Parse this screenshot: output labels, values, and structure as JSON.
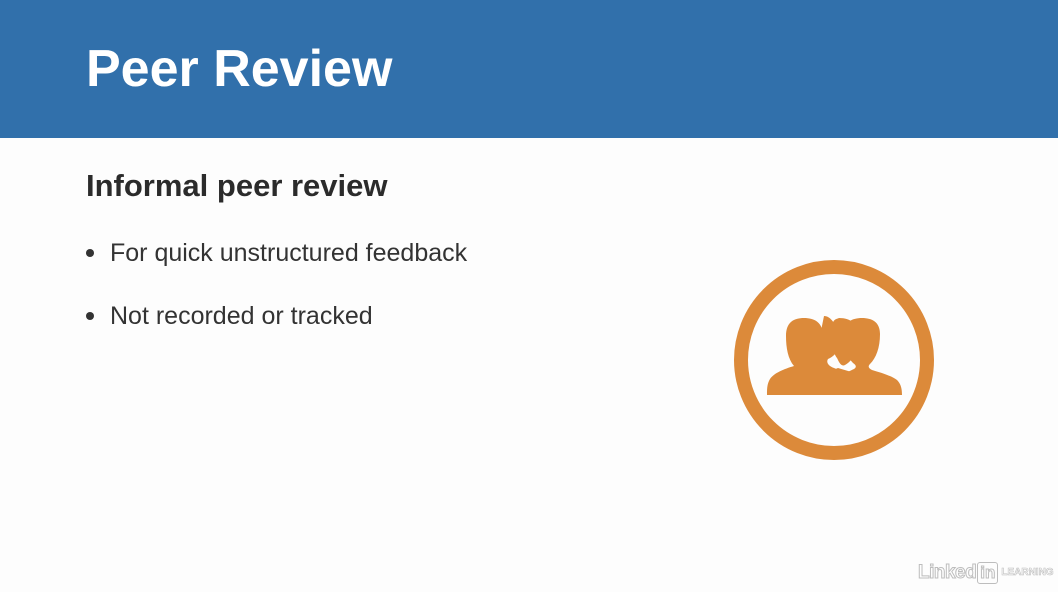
{
  "slide": {
    "title": "Peer Review",
    "heading": "Informal peer review",
    "bullets": [
      "For quick unstructured feedback",
      "Not recorded or tracked"
    ],
    "icon": "people-group-icon"
  },
  "branding": {
    "logo_word": "Linked",
    "logo_in": "in",
    "logo_sub": "LEARNING"
  },
  "colors": {
    "header": "#3170ab",
    "accent": "#dc8a3a",
    "text": "#333333",
    "background": "#fdfdfd"
  }
}
